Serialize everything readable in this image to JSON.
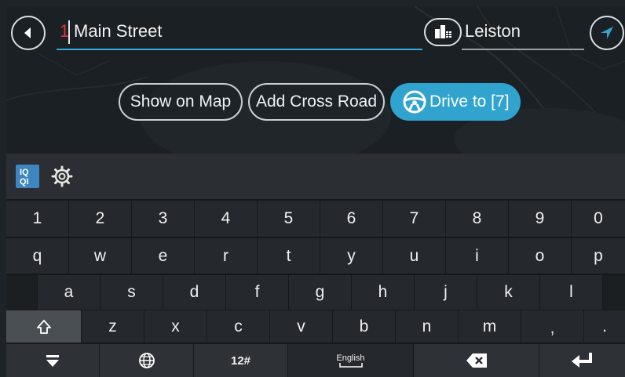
{
  "top_bar": {
    "back_icon": "back-arrow-icon",
    "street_input": {
      "house_number": "1",
      "value": "Main Street"
    },
    "city_toggle_icon": "city-buildings-icon",
    "city_input": {
      "value": "Leiston"
    },
    "nav_icon": "navigation-arrow-icon"
  },
  "actions": {
    "show_on_map": "Show on Map",
    "add_cross_road": "Add Cross Road",
    "drive_to": "Drive to [7]",
    "drive_icon": "steering-wheel-icon"
  },
  "toolbar": {
    "iq_icon": "iq-routes-icon",
    "iq_text": "IQ\nQI",
    "settings_icon": "gear-icon"
  },
  "keyboard": {
    "row_numbers": [
      "1",
      "2",
      "3",
      "4",
      "5",
      "6",
      "7",
      "8",
      "9",
      "0"
    ],
    "row_q": [
      "q",
      "w",
      "e",
      "r",
      "t",
      "y",
      "u",
      "i",
      "o",
      "p"
    ],
    "row_a": [
      "a",
      "s",
      "d",
      "f",
      "g",
      "h",
      "j",
      "k",
      "l"
    ],
    "row_z": [
      "z",
      "x",
      "c",
      "v",
      "b",
      "n",
      "m",
      ",",
      "."
    ],
    "bottom": {
      "hide_icon": "keyboard-hide-icon",
      "globe_icon": "globe-icon",
      "numeric_label": "12#",
      "language_label": "English",
      "backspace_icon": "backspace-icon",
      "enter_icon": "enter-icon"
    },
    "shift_icon": "shift-icon"
  },
  "colors": {
    "accent": "#30a3cf",
    "underline_active": "#35a9d8",
    "house_number": "#d53a33"
  }
}
